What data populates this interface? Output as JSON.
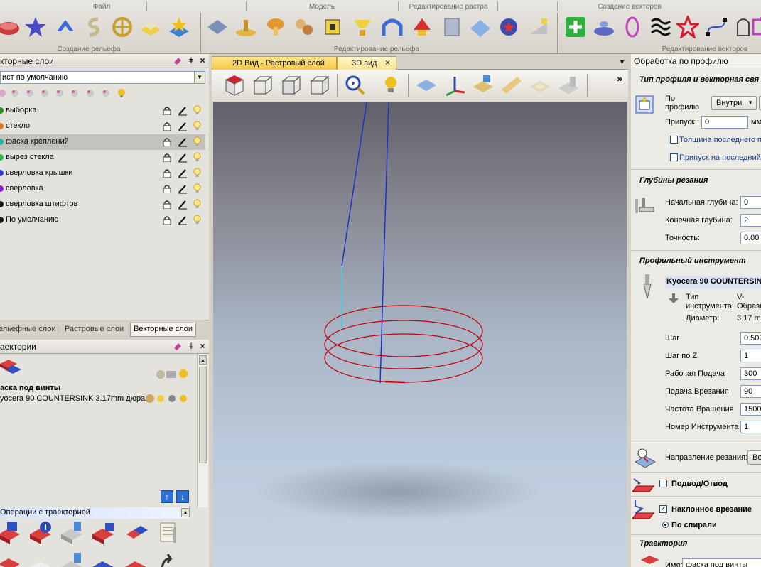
{
  "ribbon": {
    "groups_top": [
      "Файл",
      "Модель",
      "Редактирование растра",
      "Создание векторов"
    ],
    "groups_bottom": [
      "Создание рельефа",
      "Редактирование рельефа",
      "Редактирование векторов"
    ]
  },
  "layers_panel": {
    "title": "кторные слои",
    "sheet": "ист по умолчанию",
    "layers": [
      {
        "name": "выборка",
        "color": "#2a8f2a"
      },
      {
        "name": "стекло",
        "color": "#e07a1c"
      },
      {
        "name": "фаска креплений",
        "color": "#2bb0a8"
      },
      {
        "name": "вырез стекла",
        "color": "#2fb84a"
      },
      {
        "name": "сверловка крышки",
        "color": "#3a3ad8"
      },
      {
        "name": "сверловка",
        "color": "#8a1ed0"
      },
      {
        "name": "сверловка штифтов",
        "color": "#1a1a1a"
      },
      {
        "name": "По умолчанию",
        "color": "#101010"
      }
    ],
    "selected_index": 2,
    "tabs": [
      "ельефные слои",
      "Растровые слои",
      "Векторные слои"
    ],
    "active_tab": 2
  },
  "toolpaths_panel": {
    "title": "аектории",
    "toolpath_name": "аска под винты",
    "toolpath_tool": "yocera 90 COUNTERSINK 3.17mm дюраль",
    "operations_title": "Операции с траекторией"
  },
  "view": {
    "tab_2d": "2D Вид - Растровый слой",
    "tab_3d": "3D вид",
    "close": "×",
    "more": "»"
  },
  "right_panel": {
    "title": "Обработка по профилю",
    "section_profile": "Тип профиля и векторная свя",
    "profile_label": "По профилю",
    "profile_value": "Внутри",
    "allowance_label": "Припуск:",
    "allowance_value": "0",
    "allowance_unit": "мм",
    "chk_last_thickness": "Толщина последнего п",
    "chk_last_allowance": "Припуск на последний",
    "section_depth": "Глубины резания",
    "start_depth_label": "Начальная глубина:",
    "start_depth_value": "0",
    "end_depth_label": "Конечная глубина:",
    "end_depth_value": "2",
    "precision_label": "Точность:",
    "precision_value": "0.00",
    "section_tool": "Профильный инструмент",
    "tool_name": "Kyocera 90 COUNTERSIN",
    "tool_type_label": "Тип инструмента:",
    "tool_type_value": "V-Образн",
    "tool_diameter_label": "Диаметр:",
    "tool_diameter_value": "3.17 m",
    "step_label": "Шаг",
    "step_value": "0.507",
    "zstep_label": "Шаг по Z",
    "zstep_value": "1",
    "feed_label": "Рабочая Подача",
    "feed_value": "300",
    "plunge_label": "Подача Врезания",
    "plunge_value": "90",
    "spindle_label": "Частота Вращения",
    "spindle_value": "15000",
    "toolnum_label": "Номер Инструмента",
    "toolnum_value": "1",
    "direction_label": "Направление резания:",
    "direction_value": "Во",
    "leadin_label": "Подвод/Отвод",
    "ramp_label": "Наклонное врезание",
    "spiral_label": "По спирали",
    "section_toolpath": "Траектория",
    "name_label": "Имя:",
    "name_value": "фаска под винты"
  },
  "colors": {
    "accent_tab": "#f3c94a",
    "toolpath_red": "#c0000a",
    "vector_blue": "#1a2fd0",
    "plunge_cyan": "#3ad0e8"
  }
}
